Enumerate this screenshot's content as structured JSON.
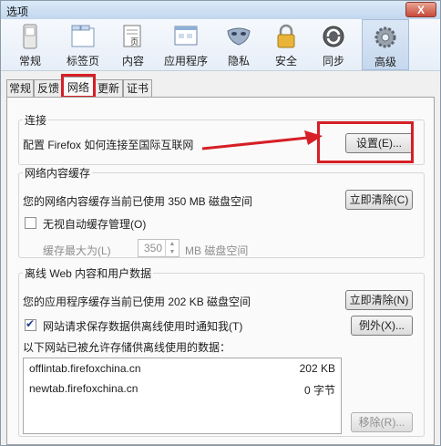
{
  "window": {
    "title": "选项",
    "close_label": "X"
  },
  "toolbar": {
    "items": [
      {
        "label": "常规",
        "icon": "switch-icon"
      },
      {
        "label": "标签页",
        "icon": "tabs-icon"
      },
      {
        "label": "内容",
        "icon": "page-icon",
        "icon_text": "页"
      },
      {
        "label": "应用程序",
        "icon": "apps-icon"
      },
      {
        "label": "隐私",
        "icon": "mask-icon"
      },
      {
        "label": "安全",
        "icon": "lock-icon"
      },
      {
        "label": "同步",
        "icon": "sync-icon"
      },
      {
        "label": "高级",
        "icon": "gear-icon",
        "selected": true
      }
    ]
  },
  "subtabs": [
    "常规",
    "反馈",
    "网络",
    "更新",
    "证书"
  ],
  "connection": {
    "title": "连接",
    "desc": "配置 Firefox 如何连接至国际互联网",
    "settings_button": "设置(E)..."
  },
  "cache": {
    "title": "网络内容缓存",
    "usage": "您的网络内容缓存当前已使用 350 MB 磁盘空间",
    "clear_button": "立即清除(C)",
    "override_label": "无视自动缓存管理(O)",
    "override_checked": false,
    "limit_label": "缓存最大为(L)",
    "limit_value": "350",
    "limit_unit": "MB 磁盘空间"
  },
  "offline": {
    "title": "离线 Web 内容和用户数据",
    "usage": "您的应用程序缓存当前已使用 202 KB 磁盘空间",
    "clear_button": "立即清除(N)",
    "notify_label": "网站请求保存数据供离线使用时通知我(T)",
    "notify_checked": true,
    "exceptions_button": "例外(X)...",
    "list_label": "以下网站已被允许存储供离线使用的数据：",
    "sites": [
      {
        "host": "offlintab.firefoxchina.cn",
        "size": "202 KB"
      },
      {
        "host": "newtab.firefoxchina.cn",
        "size": "0 字节"
      }
    ],
    "remove_button": "移除(R)..."
  },
  "colors": {
    "highlight": "#d61f26",
    "accent": "#1d3f8a"
  }
}
